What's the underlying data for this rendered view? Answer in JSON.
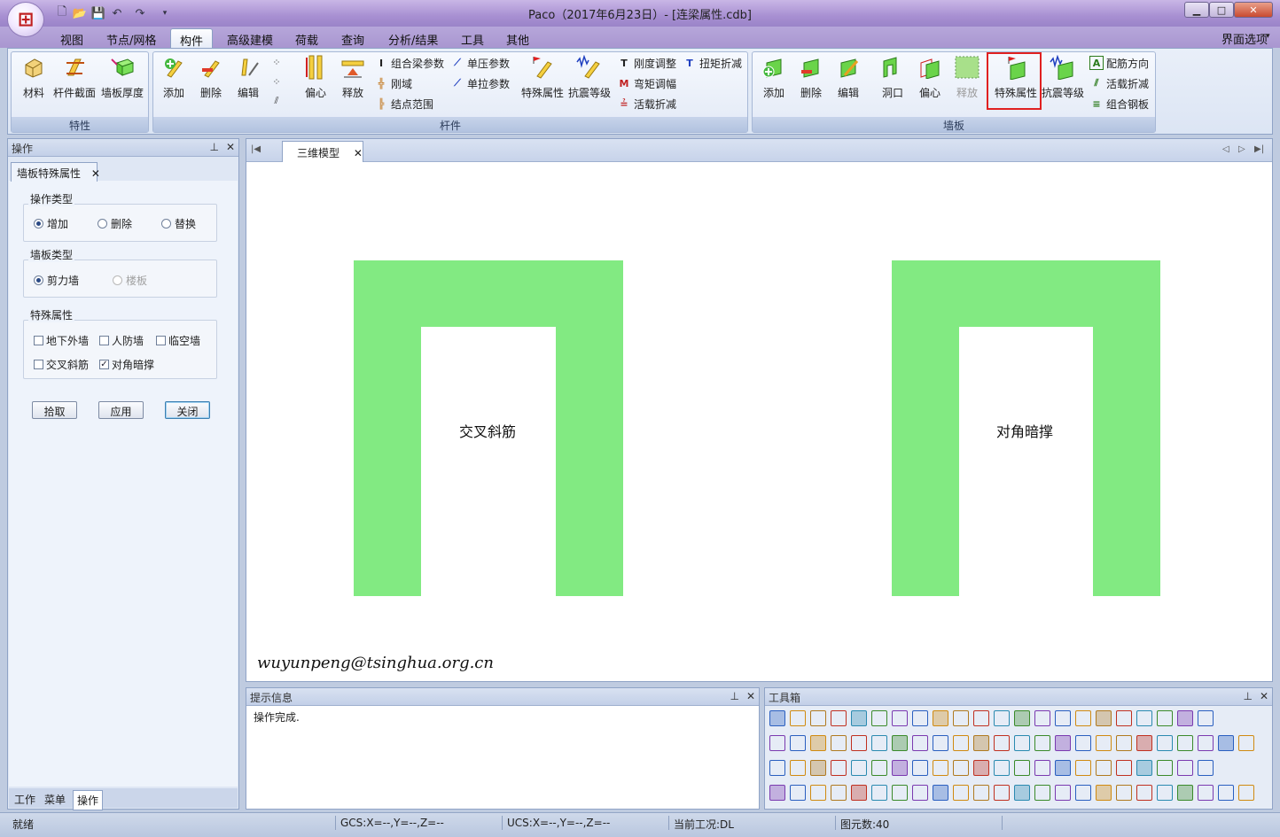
{
  "window": {
    "title": "Paco（2017年6月23日）- [连梁属性.cdb]",
    "minimize": "▁",
    "maximize": "□",
    "close": "✕"
  },
  "menu": {
    "tabs": [
      "视图",
      "节点/网格",
      "构件",
      "高级建模",
      "荷载",
      "查询",
      "分析/结果",
      "工具",
      "其他"
    ],
    "active": "构件",
    "ui_options": "界面选项"
  },
  "ribbon": {
    "groups": {
      "properties": {
        "label": "特性",
        "buttons": [
          "材料",
          "杆件截面",
          "墙板厚度"
        ]
      },
      "members": {
        "label": "杆件",
        "buttons": [
          "添加",
          "删除",
          "编辑",
          "偏心",
          "释放",
          "特殊属性",
          "抗震等级"
        ],
        "small": [
          "组合梁参数",
          "刚域",
          "结点范围",
          "单压参数",
          "单拉参数",
          "刚度调整",
          "弯矩调幅",
          "活载折减",
          "扭矩折减"
        ]
      },
      "walls": {
        "label": "墙板",
        "buttons": [
          "添加",
          "删除",
          "编辑",
          "洞口",
          "偏心",
          "释放",
          "特殊属性",
          "抗震等级"
        ],
        "small": [
          "配筋方向",
          "活载折减",
          "组合钢板"
        ]
      }
    }
  },
  "left_panel": {
    "title": "操作",
    "tab": "墙板特殊属性",
    "op_type": {
      "legend": "操作类型",
      "options": [
        "增加",
        "删除",
        "替换"
      ],
      "selected": "增加"
    },
    "wall_type": {
      "legend": "墙板类型",
      "options": [
        "剪力墙",
        "楼板"
      ],
      "selected": "剪力墙"
    },
    "special": {
      "legend": "特殊属性",
      "options": [
        "地下外墙",
        "人防墙",
        "临空墙",
        "交叉斜筋",
        "对角暗撑"
      ],
      "checked": [
        "对角暗撑"
      ]
    },
    "buttons": [
      "拾取",
      "应用",
      "关闭"
    ],
    "bottom_tabs": [
      "工作",
      "菜单",
      "操作"
    ],
    "active_bottom": "操作"
  },
  "canvas": {
    "tab": "三维模型",
    "labels": [
      "交叉斜筋",
      "对角暗撑"
    ],
    "watermark": "wuyunpeng@tsinghua.org.cn"
  },
  "info_panel": {
    "title": "提示信息",
    "text": "操作完成."
  },
  "toolbox": {
    "title": "工具箱"
  },
  "status": {
    "ready": "就绪",
    "gcs": "GCS:X=--,Y=--,Z=--",
    "ucs": "UCS:X=--,Y=--,Z=--",
    "case": "当前工况:DL",
    "count": "图元数:40"
  },
  "colors": {
    "wall_fill": "#82ea82",
    "highlight": "#e02020"
  }
}
